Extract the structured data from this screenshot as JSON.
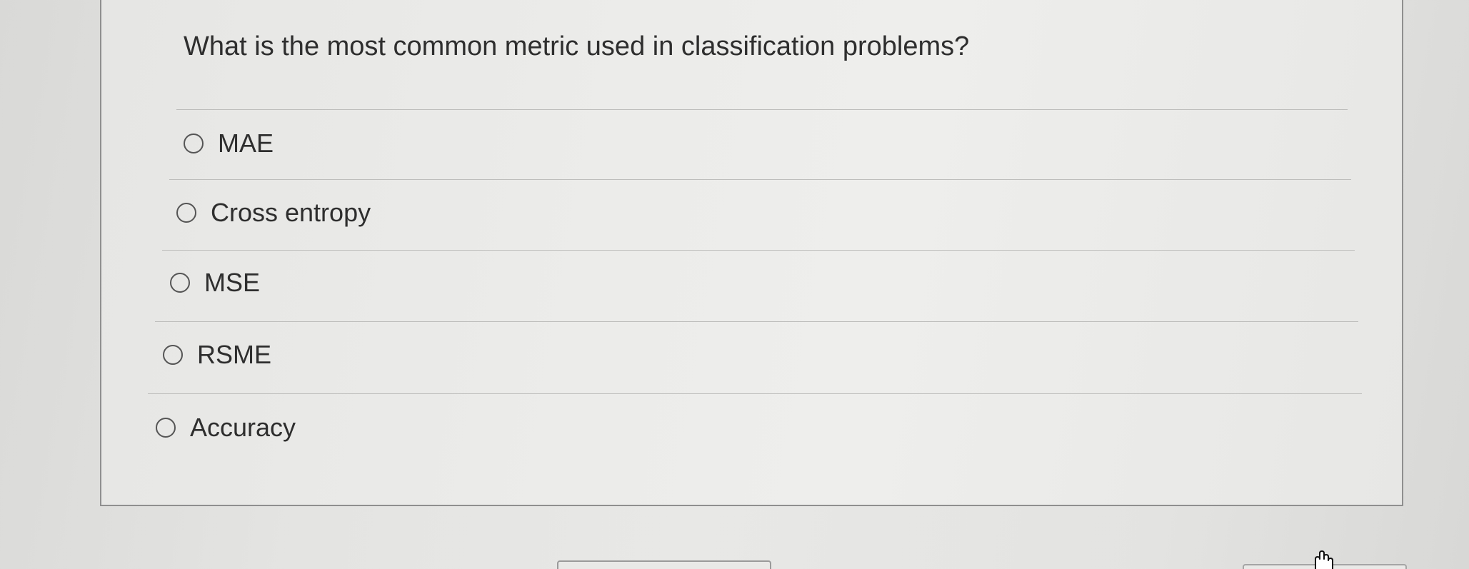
{
  "question": {
    "text": "What is the most common metric used in classification problems?"
  },
  "options": [
    {
      "label": "MAE",
      "selected": false
    },
    {
      "label": "Cross entropy",
      "selected": false
    },
    {
      "label": "MSE",
      "selected": false
    },
    {
      "label": "RSME",
      "selected": false
    },
    {
      "label": "Accuracy",
      "selected": false
    }
  ],
  "icons": {
    "cursor": "hand-pointer-icon",
    "radio": "radio-unchecked-icon"
  },
  "colors": {
    "text": "#2e2e2e",
    "card_border": "#8f8f8f",
    "divider": "#bdbdbb"
  }
}
